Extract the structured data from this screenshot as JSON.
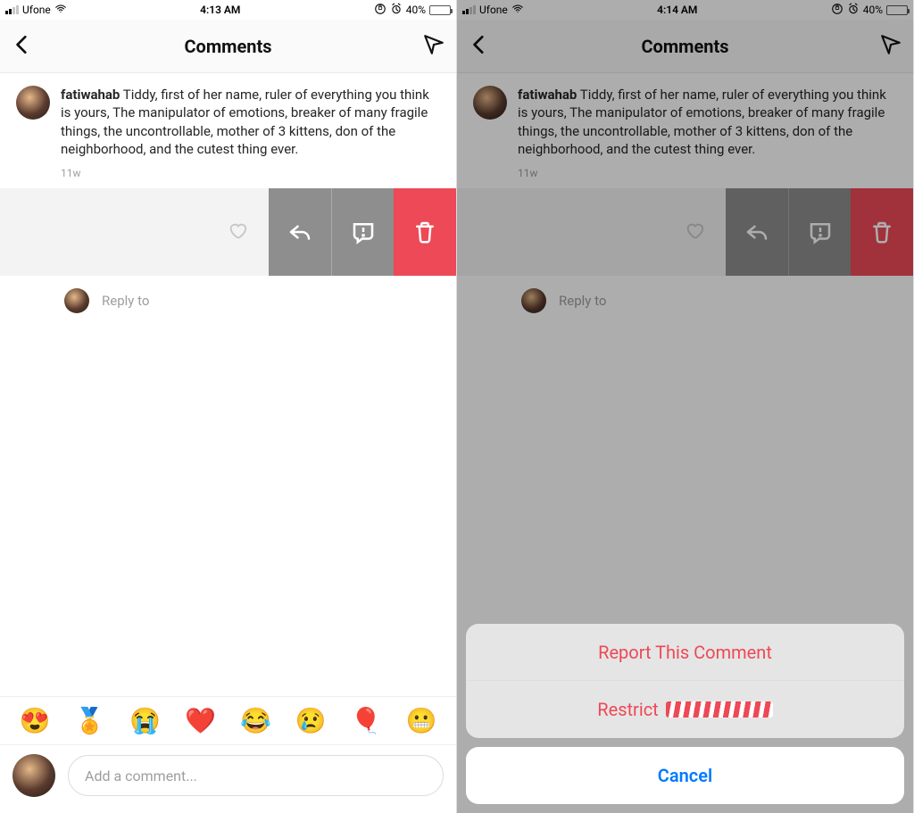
{
  "status": {
    "carrier": "Ufone",
    "time_left": "4:13 AM",
    "time_right": "4:14 AM",
    "battery_pct": "40%"
  },
  "nav": {
    "title": "Comments"
  },
  "caption": {
    "username": "fatiwahab",
    "text": "Tiddy, first of her name, ruler of everything you think is yours, The manipulator of emotions, breaker of many fragile things, the uncontrollable, mother of 3 kittens, don of the neighborhood, and the cutest thing ever.",
    "age": "11w"
  },
  "reply": {
    "label": "Reply to"
  },
  "emojis": [
    "😍",
    "🏅",
    "😭",
    "❤️",
    "😂",
    "😢",
    "🎈",
    "😬"
  ],
  "compose": {
    "placeholder": "Add a comment..."
  },
  "sheet": {
    "report": "Report This Comment",
    "restrict": "Restrict",
    "cancel": "Cancel"
  }
}
